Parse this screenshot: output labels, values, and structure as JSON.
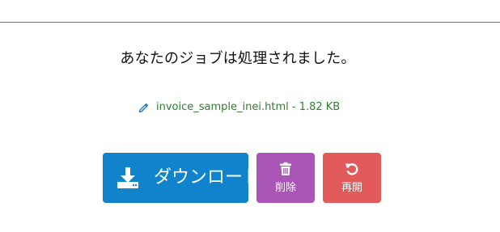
{
  "status": {
    "message": "あなたのジョブは処理されました。"
  },
  "file": {
    "icon": "pencil-icon",
    "name": "invoice_sample_inei.html",
    "separator": " - ",
    "size": "1.82 KB"
  },
  "actions": {
    "download_label": "ダウンロード",
    "download_icon": "download-icon",
    "delete_label": "削除",
    "delete_icon": "trash-icon",
    "reset_label": "再開",
    "reset_icon": "undo-icon"
  },
  "colors": {
    "rule": "#3c9b3c",
    "file_link": "#2f7f2f",
    "pencil": "#1a6fb5",
    "download_button": "#1083cc",
    "delete_button": "#a855b6",
    "reset_button": "#e25a5a"
  }
}
